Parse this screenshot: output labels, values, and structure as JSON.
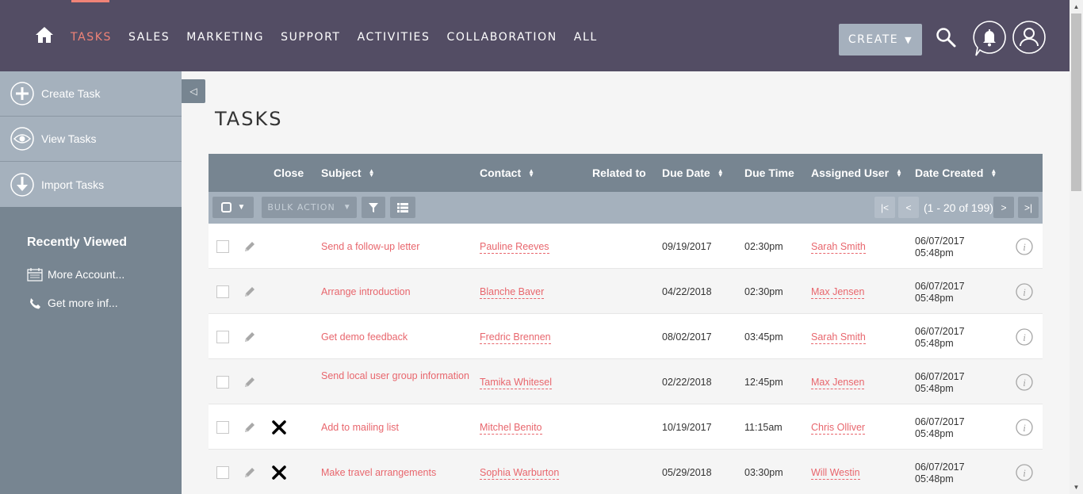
{
  "nav": {
    "items": [
      "TASKS",
      "SALES",
      "MARKETING",
      "SUPPORT",
      "ACTIVITIES",
      "COLLABORATION",
      "ALL"
    ],
    "active": "TASKS",
    "create_label": "CREATE",
    "accent_color": "#f08377",
    "bar_color": "#534d64"
  },
  "sidebar": {
    "actions": [
      {
        "label": "Create Task",
        "icon": "plus-circle-icon"
      },
      {
        "label": "View Tasks",
        "icon": "eye-icon"
      },
      {
        "label": "Import Tasks",
        "icon": "download-circle-icon"
      }
    ],
    "recent_title": "Recently Viewed",
    "recent": [
      {
        "label": "More Account...",
        "icon": "calendar-icon"
      },
      {
        "label": "Get more inf...",
        "icon": "phone-icon"
      }
    ]
  },
  "page": {
    "title": "TASKS"
  },
  "table": {
    "headers": {
      "close": "Close",
      "subject": "Subject",
      "contact": "Contact",
      "related": "Related to",
      "due_date": "Due Date",
      "due_time": "Due Time",
      "assigned": "Assigned User",
      "created": "Date Created"
    },
    "bulk_action": "BULK ACTION",
    "pagination": "(1 - 20 of 199)",
    "rows": [
      {
        "subject": "Send a follow-up letter",
        "contact": "Pauline Reeves",
        "due_date": "09/19/2017",
        "due_time": "02:30pm",
        "assigned": "Sarah Smith",
        "created_date": "06/07/2017",
        "created_time": "05:48pm",
        "close": false
      },
      {
        "subject": "Arrange introduction",
        "contact": "Blanche Baver",
        "due_date": "04/22/2018",
        "due_time": "02:30pm",
        "assigned": "Max Jensen",
        "created_date": "06/07/2017",
        "created_time": "05:48pm",
        "close": false
      },
      {
        "subject": "Get demo feedback",
        "contact": "Fredric Brennen",
        "due_date": "08/02/2017",
        "due_time": "03:45pm",
        "assigned": "Sarah Smith",
        "created_date": "06/07/2017",
        "created_time": "05:48pm",
        "close": false
      },
      {
        "subject": "Send local user group information",
        "contact": "Tamika Whitesel",
        "due_date": "02/22/2018",
        "due_time": "12:45pm",
        "assigned": "Max Jensen",
        "created_date": "06/07/2017",
        "created_time": "05:48pm",
        "close": false
      },
      {
        "subject": "Add to mailing list",
        "contact": "Mitchel Benito",
        "due_date": "10/19/2017",
        "due_time": "11:15am",
        "assigned": "Chris Olliver",
        "created_date": "06/07/2017",
        "created_time": "05:48pm",
        "close": true
      },
      {
        "subject": "Make travel arrangements",
        "contact": "Sophia Warburton",
        "due_date": "05/29/2018",
        "due_time": "03:30pm",
        "assigned": "Will Westin",
        "created_date": "06/07/2017",
        "created_time": "05:48pm",
        "close": true
      }
    ]
  }
}
